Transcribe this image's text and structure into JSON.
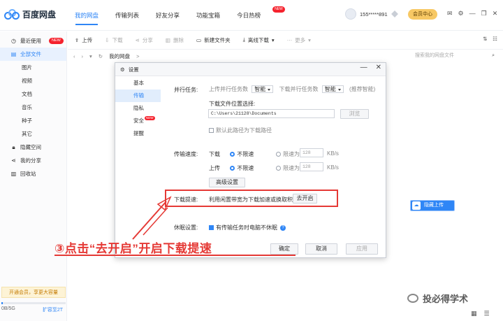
{
  "app": {
    "name": "百度网盘",
    "nav": [
      "我的网盘",
      "传输列表",
      "好友分享",
      "功能宝箱",
      "今日热榜"
    ],
    "nav_badge": "NEW",
    "user_name": "155*****891",
    "vip_button": "会员中心",
    "window_icons": [
      "✉",
      "⚙",
      "—",
      "❐",
      "✕"
    ]
  },
  "sidebar": {
    "items": [
      {
        "label": "最近使用",
        "icon": "clock-icon",
        "badge": "NEW"
      },
      {
        "label": "全部文件",
        "icon": "file-icon"
      },
      {
        "label": "图片"
      },
      {
        "label": "视频"
      },
      {
        "label": "文档"
      },
      {
        "label": "音乐"
      },
      {
        "label": "种子"
      },
      {
        "label": "其它"
      },
      {
        "label": "隐藏空间",
        "icon": "lock-icon"
      },
      {
        "label": "我的分享",
        "icon": "share-icon"
      },
      {
        "label": "回收站",
        "icon": "trash-icon"
      }
    ],
    "promo": "开通会员，享更大容量",
    "quota_used": "0B/5G",
    "quota_upgrade": "扩容至2T",
    "quota_fraction": 0.02
  },
  "toolbar": {
    "upload": "上传",
    "download": "下载",
    "share": "分享",
    "delete": "删除",
    "new_folder": "新建文件夹",
    "offline": "离线下载",
    "more": "更多"
  },
  "path": {
    "crumb": "我的网盘",
    "separator": ">",
    "search_placeholder": "搜索我的网盘文件"
  },
  "float_button": "隐藏上传",
  "dialog": {
    "title": "设置",
    "nav": [
      "基本",
      "传输",
      "隐私",
      "安全",
      "提醒"
    ],
    "nav_badge": "NEW",
    "parallel_label": "并行任务:",
    "upload_parallel_label": "上传并行任务数",
    "upload_parallel_value": "智能",
    "download_parallel_label": "下载并行任务数",
    "download_parallel_value": "智能",
    "recommend": "(推荐智能)",
    "download_path_label": "下载文件位置选择:",
    "download_path_value": "C:\\Users\\21128\\Documents",
    "browse": "浏览",
    "default_path_checkbox": "默认此路径为下载路径",
    "speed_label": "传输速度:",
    "download_label": "下载",
    "upload_label": "上传",
    "unlimited": "不限速",
    "limit_to": "限速为",
    "limit_value": "128",
    "unit": "KB/s",
    "advanced": "高级设置",
    "boost_label": "下载提速:",
    "boost_desc": "利用闲置带宽为下载加速或换取积分",
    "boost_button": "去开启",
    "sleep_label": "休眠设置:",
    "sleep_checkbox": "有传输任务时电脑不休眠",
    "ok": "确定",
    "cancel": "取消",
    "apply": "应用"
  },
  "annotation": "③点击“去开启”开启下载提速",
  "watermark": "投必得学术"
}
